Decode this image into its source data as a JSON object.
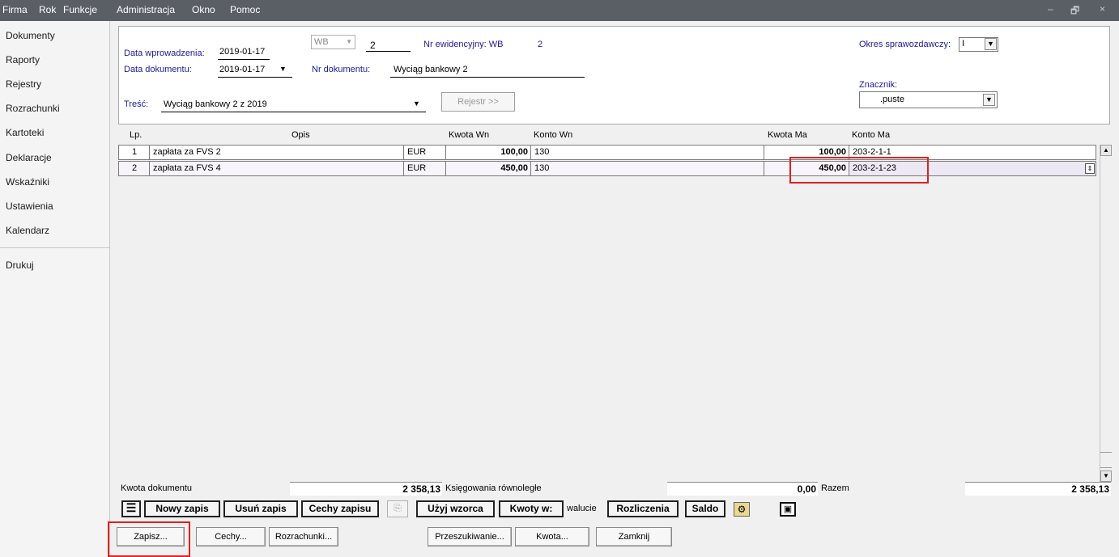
{
  "menu": {
    "items": [
      "Firma",
      "Rok",
      "Funkcje",
      "Administracja",
      "Okno",
      "Pomoc"
    ]
  },
  "window_controls": {
    "minimize": "–",
    "restore": "🗗",
    "close": "×"
  },
  "sidebar": {
    "items": [
      "Dokumenty",
      "Raporty",
      "Rejestry",
      "Rozrachunki",
      "Kartoteki",
      "Deklaracje",
      "Wskaźniki",
      "Ustawienia",
      "Kalendarz",
      "Drukuj"
    ]
  },
  "header": {
    "data_wprowadzenia_label": "Data wprowadzenia:",
    "data_wprowadzenia_value": "2019-01-17",
    "journal_code": "WB",
    "journal_number": "2",
    "nr_ewidencyjny_label": "Nr ewidencyjny: WB",
    "nr_ewidencyjny_value": "2",
    "okres_label": "Okres sprawozdawczy:",
    "okres_value": "I",
    "data_dokumentu_label": "Data dokumentu:",
    "data_dokumentu_value": "2019-01-17",
    "nr_dokumentu_label": "Nr dokumentu:",
    "nr_dokumentu_value": "Wyciąg bankowy 2",
    "znacznik_label": "Znacznik:",
    "znacznik_value": ".puste",
    "tresc_label": "Treść:",
    "tresc_value": "Wyciąg bankowy 2 z 2019",
    "rejestr_button": "Rejestr >>"
  },
  "grid": {
    "columns": {
      "lp": "Lp.",
      "opis": "Opis",
      "kwota_wn": "Kwota Wn",
      "konto_wn": "Konto Wn",
      "kwota_ma": "Kwota Ma",
      "konto_ma": "Konto Ma"
    },
    "rows": [
      {
        "lp": "1",
        "opis": "zapłata za FVS 2",
        "waluta": "EUR",
        "kwota_wn": "100,00",
        "konto_wn": "130",
        "kwota_ma": "100,00",
        "konto_ma": "203-2-1-1"
      },
      {
        "lp": "2",
        "opis": "zapłata za FVS 4",
        "waluta": "EUR",
        "kwota_wn": "450,00",
        "konto_wn": "130",
        "kwota_ma": "450,00",
        "konto_ma": "203-2-1-23"
      }
    ]
  },
  "totals": {
    "kwota_dokumentu_label": "Kwota dokumentu",
    "kwota_dokumentu_value": "2 358,13",
    "ksiegowania_label": "Księgowania równoległe",
    "ksiegowania_value": "0,00",
    "razem_label": "Razem",
    "razem_value": "2 358,13"
  },
  "toolbar": {
    "nowy_zapis": "Nowy zapis",
    "usun_zapis": "Usuń zapis",
    "cechy_zapisu": "Cechy zapisu",
    "uzyj_wzorca": "Użyj wzorca",
    "kwoty_w": "Kwoty w:",
    "walucie": "walucie",
    "rozliczenia": "Rozliczenia",
    "saldo": "Saldo"
  },
  "bottom": {
    "zapisz": "Zapisz...",
    "cechy": "Cechy...",
    "rozrachunki": "Rozrachunki...",
    "przeszukiwanie": "Przeszukiwanie...",
    "kwota": "Kwota...",
    "zamknij": "Zamknij"
  }
}
